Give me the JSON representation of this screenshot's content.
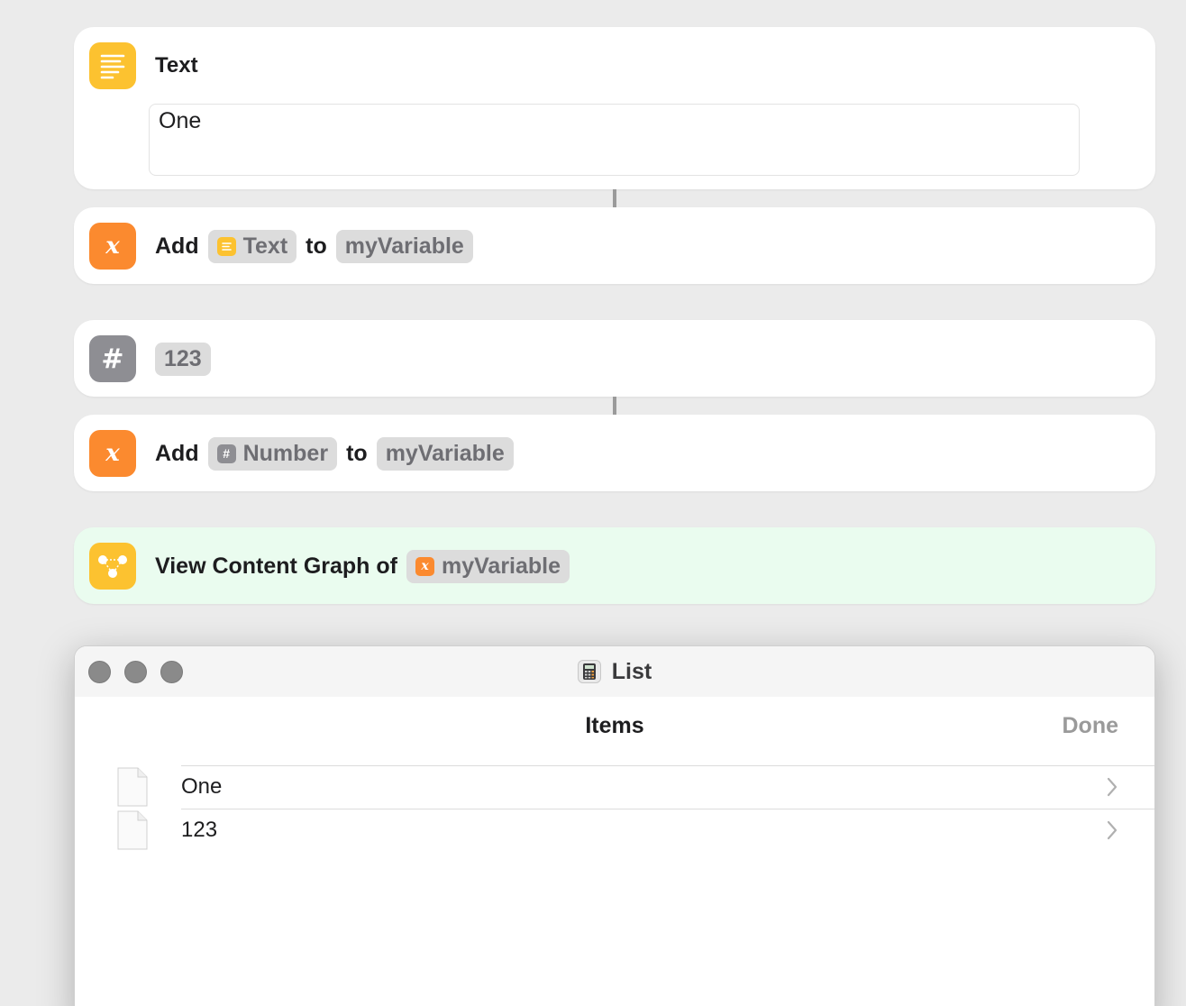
{
  "actions": {
    "text_action": {
      "title": "Text",
      "value": "One",
      "icon": "text-lines-icon"
    },
    "add_text": {
      "verb": "Add",
      "token": "Text",
      "connector": "to",
      "variable": "myVariable",
      "icon": "variable-x-icon"
    },
    "number_action": {
      "value": "123",
      "icon": "hash-icon"
    },
    "add_number": {
      "verb": "Add",
      "token": "Number",
      "connector": "to",
      "variable": "myVariable",
      "icon": "variable-x-icon"
    },
    "view_graph": {
      "label": "View Content Graph of",
      "variable": "myVariable",
      "icon": "graph-nodes-icon"
    }
  },
  "window": {
    "title": "List",
    "title_icon": "calculator-icon",
    "nav_title": "Items",
    "done_label": "Done",
    "items": [
      {
        "label": "One",
        "icon": "document-icon"
      },
      {
        "label": "123",
        "icon": "document-icon"
      }
    ]
  },
  "colors": {
    "background": "#ebebeb",
    "yellow": "#fcc230",
    "orange": "#fb8a2f",
    "gray": "#8e8e93",
    "highlight": "#eafcef"
  }
}
